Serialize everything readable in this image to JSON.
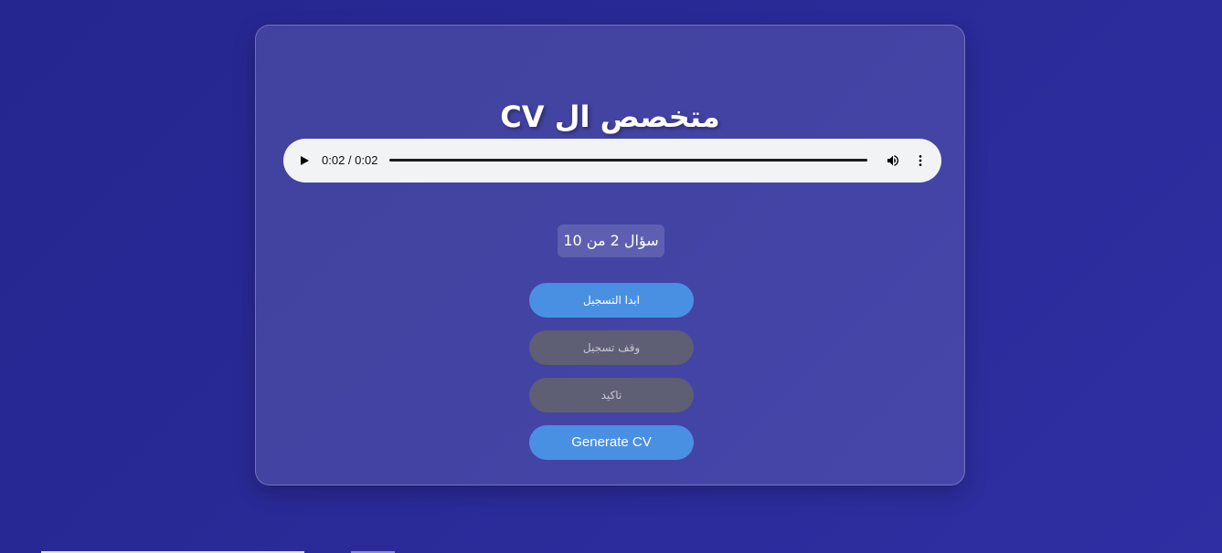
{
  "page": {
    "title": "متخصص ال CV"
  },
  "audio_player": {
    "time": "0:02 / 0:02",
    "progress": 1.0,
    "play_icon": "play-icon",
    "volume_icon": "volume-icon",
    "more_icon": "more-vertical-icon"
  },
  "question_counter": {
    "text": "سؤال 2 من 10"
  },
  "buttons": {
    "start_recording": "ابدا التسجيل",
    "stop_recording": "وقف تسجيل",
    "confirm": "تاكيد",
    "generate_cv": "Generate CV"
  },
  "colors": {
    "background": "#2a2a98",
    "accent": "#4a90e2",
    "disabled": "#5e5e74",
    "player": "#f1f3f4"
  }
}
